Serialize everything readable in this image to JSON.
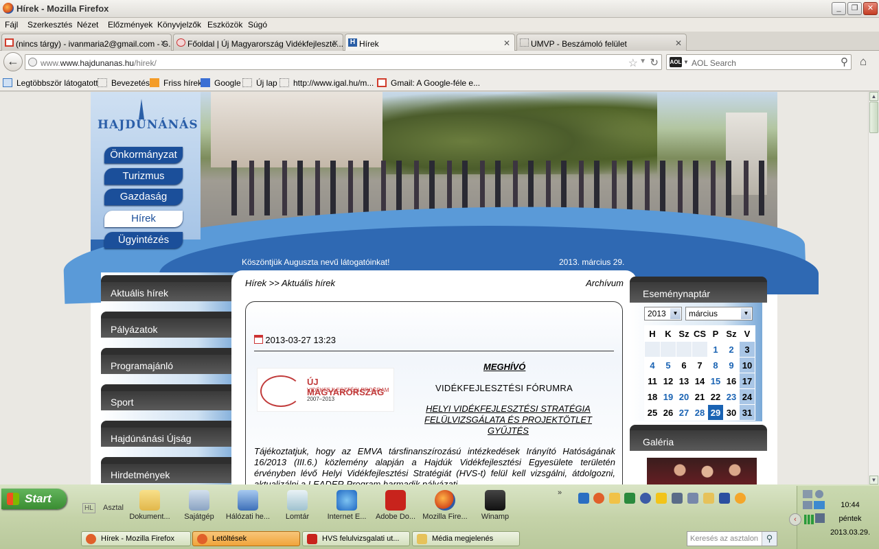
{
  "window": {
    "title": "Hírek - Mozilla Firefox"
  },
  "menu": [
    "Fájl",
    "Szerkesztés",
    "Nézet",
    "Előzmények",
    "Könyvjelzők",
    "Eszközök",
    "Súgó"
  ],
  "tabs": [
    {
      "label": "(nincs tárgy) - ivanmaria2@gmail.com - G..."
    },
    {
      "label": "Főoldal | Új Magyarország Vidékfejleszté..."
    },
    {
      "label": "Hírek"
    },
    {
      "label": "UMVP - Beszámoló felület"
    }
  ],
  "url": {
    "host": "www.hajdunanas.hu",
    "path": "/hirek/"
  },
  "search": {
    "placeholder": "AOL Search",
    "engine": "AOL"
  },
  "bookmarks": [
    "Legtöbbször látogatott",
    "Bevezetés",
    "Friss hírek",
    "Google",
    "Új lap",
    "http://www.igal.hu/m...",
    "Gmail: A Google-féle e..."
  ],
  "site": {
    "logo": "HAJDÚNÁNÁS",
    "nav": [
      "Önkormányzat",
      "Turizmus",
      "Gazdaság",
      "Hírek",
      "Ügyintézés"
    ],
    "welcome": "Köszöntjük Auguszta nevű látogatóinkat!",
    "date": "2013. március 29.",
    "left_menu": [
      "Aktuális hírek",
      "Pályázatok",
      "Programajánló",
      "Sport",
      "Hajdúnánási Újság",
      "Hirdetmények"
    ],
    "breadcrumb": "Hírek >> Aktuális hírek",
    "archive": "Archívum",
    "article": {
      "datetime": "2013-03-27 13:23",
      "logo_line1": "ÚJ MAGYARORSZÁG",
      "logo_line2": "VIDÉKFEJLESZTÉSI PROGRAM",
      "logo_line3": "2007–2013",
      "heading": "MEGHÍVÓ",
      "subheading": "VIDÉKFEJLESZTÉSI FÓRUMRA",
      "subtitle": "HELYI VIDÉKFEJLESZTÉSI STRATÉGIA FELÜLVIZSGÁLATA ÉS PROJEKTÖTLET GYŰJTÉS",
      "body": "Tájékoztatjuk, hogy az EMVA társfinanszírozású intézkedések Irányító Hatóságának 16/2013 (III.6.) közlemény alapján a Hajdúk Vidékfejlesztési Egyesülete területén érvényben lévő Helyi Vidékfejlesztési Stratégiát (HVS-t) felül kell vizsgálni, átdolgozni, aktualizálni a LEADER Program harmadik pályázati"
    },
    "calendar": {
      "title": "Eseménynaptár",
      "year": "2013",
      "month": "március",
      "weekdays": [
        "H",
        "K",
        "Sz",
        "CS",
        "P",
        "Sz",
        "V"
      ],
      "weeks": [
        [
          "",
          "",
          "",
          "",
          "1",
          "2",
          "3"
        ],
        [
          "4",
          "5",
          "6",
          "7",
          "8",
          "9",
          "10"
        ],
        [
          "11",
          "12",
          "13",
          "14",
          "15",
          "16",
          "17"
        ],
        [
          "18",
          "19",
          "20",
          "21",
          "22",
          "23",
          "24"
        ],
        [
          "25",
          "26",
          "27",
          "28",
          "29",
          "30",
          "31"
        ]
      ],
      "today": "29",
      "event_days": [
        "1",
        "2",
        "4",
        "5",
        "8",
        "9",
        "15",
        "19",
        "20",
        "23",
        "27",
        "28"
      ]
    },
    "gallery_title": "Galéria"
  },
  "taskbar": {
    "start": "Start",
    "desktop_label": "Asztal",
    "hl": "HL",
    "quick": [
      "Dokument...",
      "Sajátgép",
      "Hálózati he...",
      "Lomtár",
      "Internet E...",
      "Adobe Do...",
      "Mozilla Fire...",
      "Winamp"
    ],
    "windows": [
      "Hírek - Mozilla Firefox",
      "Letöltések",
      "HVS felulvizsgalati ut...",
      "Média megjelenés"
    ],
    "desk_search": "Keresés az asztalon",
    "time": "10:44",
    "day": "péntek",
    "date": "2013.03.29."
  }
}
